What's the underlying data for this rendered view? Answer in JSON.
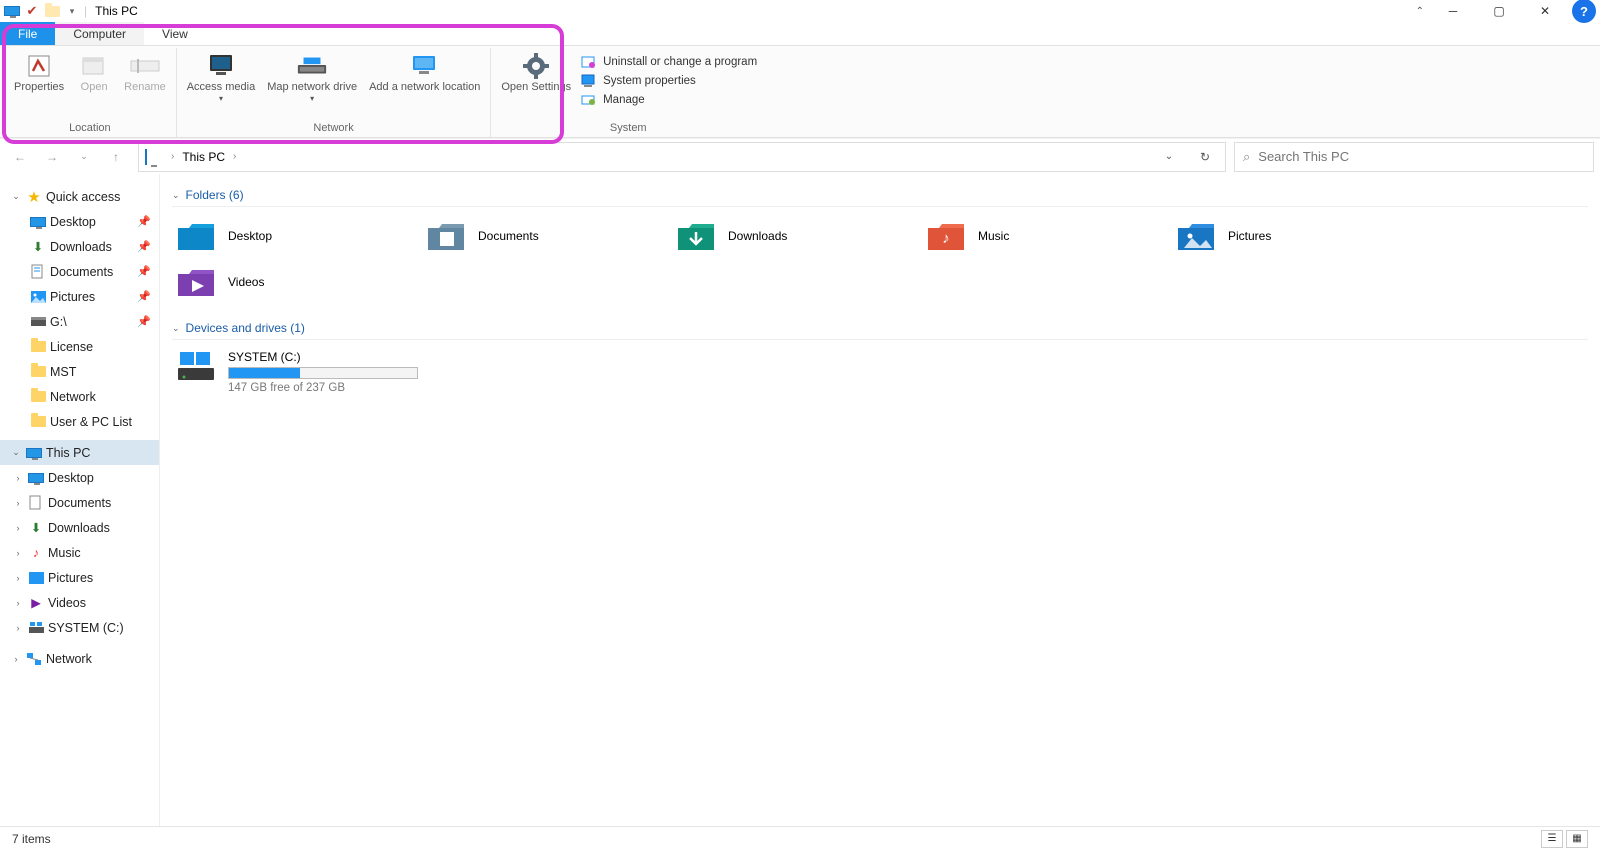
{
  "titlebar": {
    "title": "This PC"
  },
  "tabs": {
    "file": "File",
    "computer": "Computer",
    "view": "View"
  },
  "ribbon": {
    "location": {
      "label": "Location",
      "properties": "Properties",
      "open": "Open",
      "rename": "Rename"
    },
    "network": {
      "label": "Network",
      "access_media": "Access media",
      "map_drive": "Map network drive",
      "add_location": "Add a network location"
    },
    "system": {
      "label": "System",
      "open_settings": "Open Settings",
      "uninstall": "Uninstall or change a program",
      "sys_props": "System properties",
      "manage": "Manage"
    }
  },
  "address": {
    "location": "This PC"
  },
  "search": {
    "placeholder": "Search This PC"
  },
  "tree": {
    "quick_access": "Quick access",
    "desktop": "Desktop",
    "downloads": "Downloads",
    "documents": "Documents",
    "pictures": "Pictures",
    "gdrive": "G:\\",
    "license": "License",
    "mst": "MST",
    "network_f": "Network",
    "userpc": "User & PC List",
    "this_pc": "This PC",
    "pc_desktop": "Desktop",
    "pc_documents": "Documents",
    "pc_downloads": "Downloads",
    "pc_music": "Music",
    "pc_pictures": "Pictures",
    "pc_videos": "Videos",
    "pc_system": "SYSTEM (C:)",
    "network": "Network"
  },
  "sections": {
    "folders": "Folders (6)",
    "drives": "Devices and drives (1)"
  },
  "folders": {
    "desktop": "Desktop",
    "documents": "Documents",
    "downloads": "Downloads",
    "music": "Music",
    "pictures": "Pictures",
    "videos": "Videos"
  },
  "drive": {
    "name": "SYSTEM (C:)",
    "free_text": "147 GB free of 237 GB",
    "used_pct": 38
  },
  "status": {
    "items": "7 items"
  }
}
